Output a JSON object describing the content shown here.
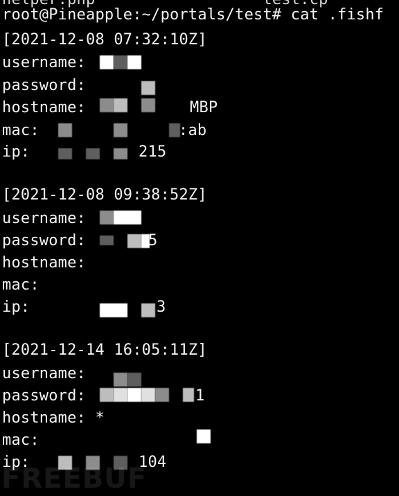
{
  "terminal": {
    "top_partial": "helper.php                  test.cp",
    "prompt": "root@Pineapple:~/portals/test# cat .fishf",
    "records": [
      {
        "timestamp": "[2021-12-08 07:32:10Z]",
        "username": "username:",
        "password": "password:",
        "hostname": "hostname:",
        "hostname_tail": "MBP",
        "mac": "mac:",
        "mac_tail": ":ab",
        "ip": "ip:",
        "ip_tail": "215"
      },
      {
        "timestamp": "[2021-12-08 09:38:52Z]",
        "username": "username:",
        "password": "password:",
        "password_tail": "5",
        "hostname": "hostname:",
        "mac": "mac:",
        "ip": "ip:",
        "ip_tail": "3"
      },
      {
        "timestamp": "[2021-12-14 16:05:11Z]",
        "username": "username:",
        "password": "password:",
        "password_tail": "1",
        "hostname": "hostname: *",
        "mac": "mac:",
        "ip": "ip:",
        "ip_tail": "104"
      }
    ]
  },
  "watermark": "FREEBUF",
  "colors": {
    "background": "#000000",
    "text": "#f2f2f2"
  }
}
